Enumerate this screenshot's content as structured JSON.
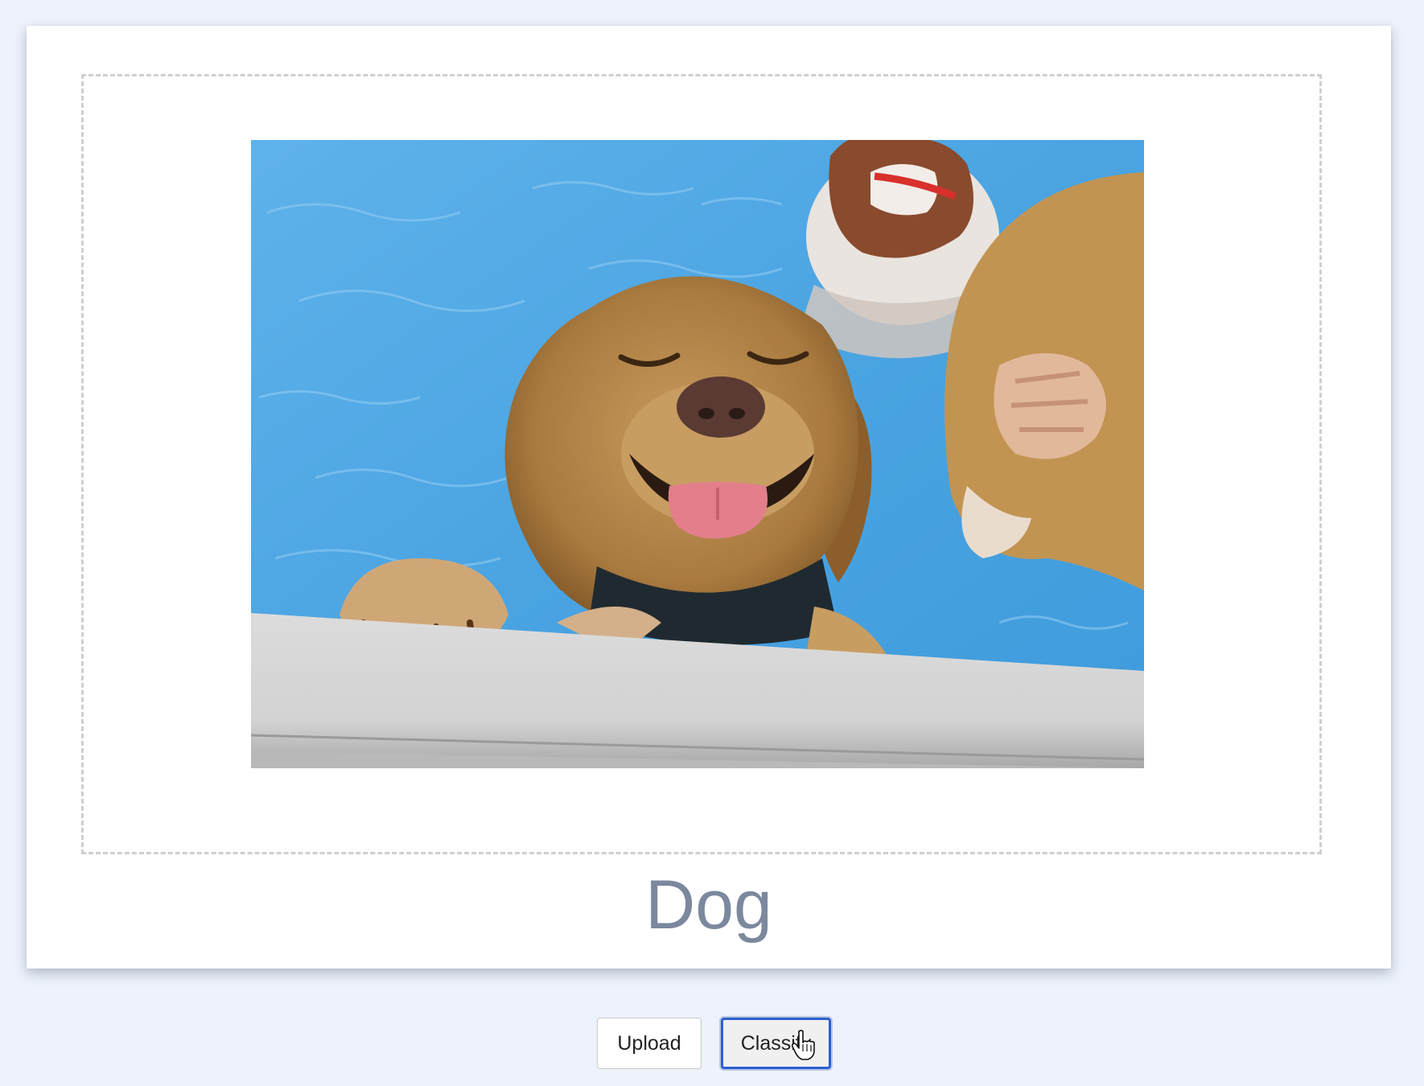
{
  "result": {
    "label": "Dog"
  },
  "image": {
    "subject": "dog-in-pool-photo"
  },
  "buttons": {
    "upload_label": "Upload",
    "classify_label": "Classify"
  },
  "colors": {
    "page_background": "#edf2fb",
    "card_background": "#ffffff",
    "drop_zone_border": "#cfcfcf",
    "result_text": "#7b889e",
    "focus_ring": "#2b5fd0"
  }
}
